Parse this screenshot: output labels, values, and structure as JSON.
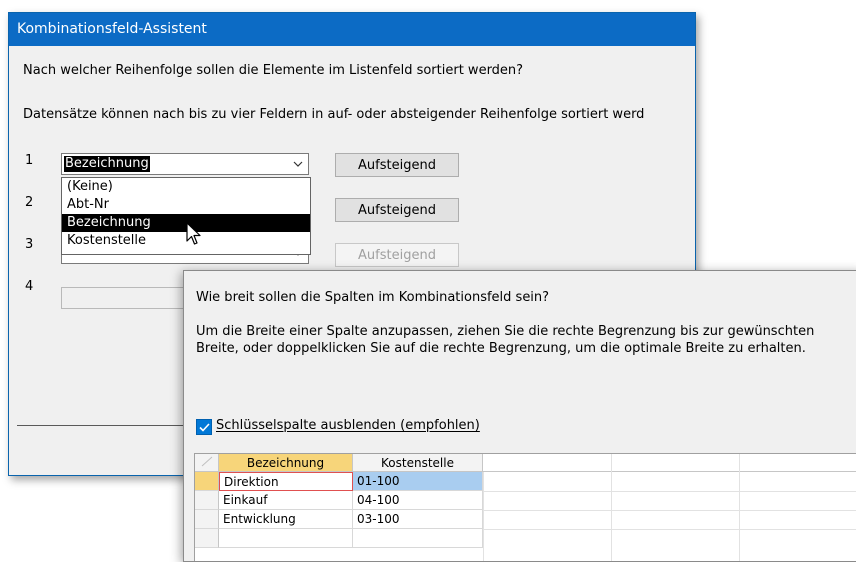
{
  "dialog1": {
    "title": "Kombinationsfeld-Assistent",
    "question": "Nach welcher Reihenfolge sollen die Elemente im Listenfeld sortiert werden?",
    "description": "Datensätze können nach bis zu vier Feldern in auf- oder absteigender Reihenfolge sortiert werd",
    "rows": [
      {
        "number": "1",
        "combo_value": "Bezeichnung",
        "button": "Aufsteigend"
      },
      {
        "number": "2",
        "combo_value": "",
        "button": "Aufsteigend"
      },
      {
        "number": "3",
        "combo_value": "",
        "button": "Aufsteigend"
      },
      {
        "number": "4",
        "combo_value": ""
      }
    ],
    "dropdown_options": [
      "(Keine)",
      "Abt-Nr",
      "Bezeichnung",
      "Kostenstelle"
    ],
    "dropdown_highlighted": "Bezeichnung"
  },
  "dialog2": {
    "question": "Wie breit sollen die Spalten im Kombinationsfeld sein?",
    "instruction_line1": "Um die Breite einer Spalte anzupassen, ziehen Sie die rechte Begrenzung bis zur gewünschten",
    "instruction_line2": "Breite, oder doppelklicken Sie auf die rechte Begrenzung, um die optimale Breite zu erhalten.",
    "checkbox_label": "Schlüsselspalte ausblenden (empfohlen)",
    "checkbox_checked": true,
    "grid": {
      "headers": [
        "Bezeichnung",
        "Kostenstelle"
      ],
      "rows": [
        [
          "Direktion",
          "01-100"
        ],
        [
          "Einkauf",
          "04-100"
        ],
        [
          "Entwicklung",
          "03-100"
        ]
      ]
    }
  },
  "colors": {
    "titlebar": "#0c6bc5",
    "highlight": "#000000",
    "checkbox": "#0078d7",
    "active_header": "#f7d57a",
    "selected_cell": "#a9cdf0"
  },
  "icons": {
    "cursor": "mouse-pointer-icon",
    "chevron": "chevron-down-icon",
    "check": "checkmark-icon"
  }
}
